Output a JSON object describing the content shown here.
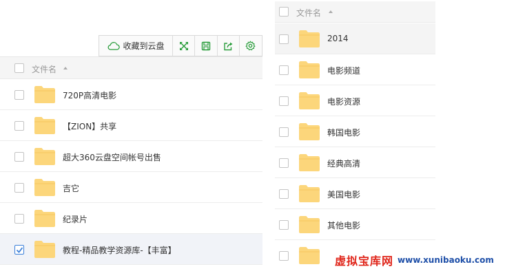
{
  "left_panel": {
    "toolbar": {
      "save_to_cloud_label": "收藏到云盘",
      "icons": [
        "cloud-icon",
        "fullscreen-icon",
        "save-disk-icon",
        "share-icon",
        "settings-icon"
      ]
    },
    "header": {
      "column_label": "文件名"
    },
    "rows": [
      {
        "name": "720P高清电影",
        "checked": false
      },
      {
        "name": "【ZION】共享",
        "checked": false
      },
      {
        "name": "超大360云盘空间帐号出售",
        "checked": false
      },
      {
        "name": "吉它",
        "checked": false
      },
      {
        "name": "纪录片",
        "checked": false
      },
      {
        "name": "教程-精品教学资源库-【丰富】",
        "checked": true
      }
    ]
  },
  "right_panel": {
    "header": {
      "column_label": "文件名"
    },
    "rows": [
      {
        "name": "2014",
        "checked": false
      },
      {
        "name": "电影频道",
        "checked": false
      },
      {
        "name": "电影资源",
        "checked": false
      },
      {
        "name": "韩国电影",
        "checked": false
      },
      {
        "name": "经典高清",
        "checked": false
      },
      {
        "name": "美国电影",
        "checked": false
      },
      {
        "name": "其他电影",
        "checked": false
      },
      {
        "name": "",
        "checked": false
      }
    ]
  },
  "watermark": {
    "main_text": "虚拟宝库网",
    "url_text": "www.xunibaoku.com"
  },
  "colors": {
    "accent_green": "#2a9d3c",
    "folder_yellow": "#fcd67b",
    "checkbox_blue": "#3b7fd9",
    "watermark_red": "#e0261b",
    "watermark_blue": "#1e4fa8"
  }
}
